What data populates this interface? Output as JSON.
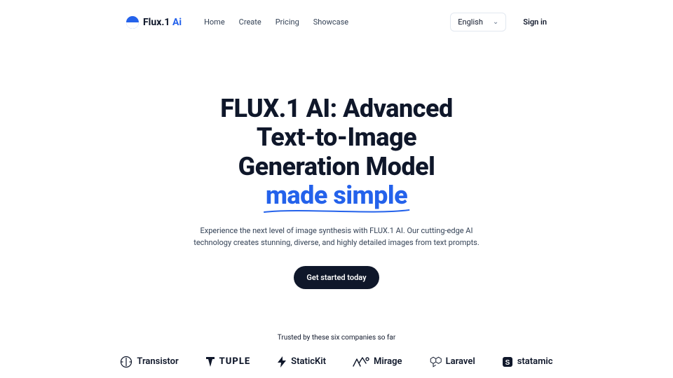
{
  "logo": {
    "text1": "Flux.1 ",
    "text2": "Ai"
  },
  "nav": {
    "items": [
      "Home",
      "Create",
      "Pricing",
      "Showcase"
    ]
  },
  "header": {
    "language": "English",
    "signin": "Sign in"
  },
  "hero": {
    "title_line1": "FLUX.1 AI: Advanced",
    "title_line2": "Text-to-Image",
    "title_line3": "Generation Model",
    "accent": "made simple",
    "description": "Experience the next level of image synthesis with FLUX.1 AI. Our cutting-edge AI technology creates stunning, diverse, and highly detailed images from text prompts.",
    "cta": "Get started today"
  },
  "trusted": {
    "label": "Trusted by these six companies so far",
    "brands": [
      "Transistor",
      "TUPLE",
      "StaticKit",
      "Mirage",
      "Laravel",
      "statamic"
    ]
  },
  "colors": {
    "accent": "#2462eb",
    "dark": "#0f172a"
  }
}
